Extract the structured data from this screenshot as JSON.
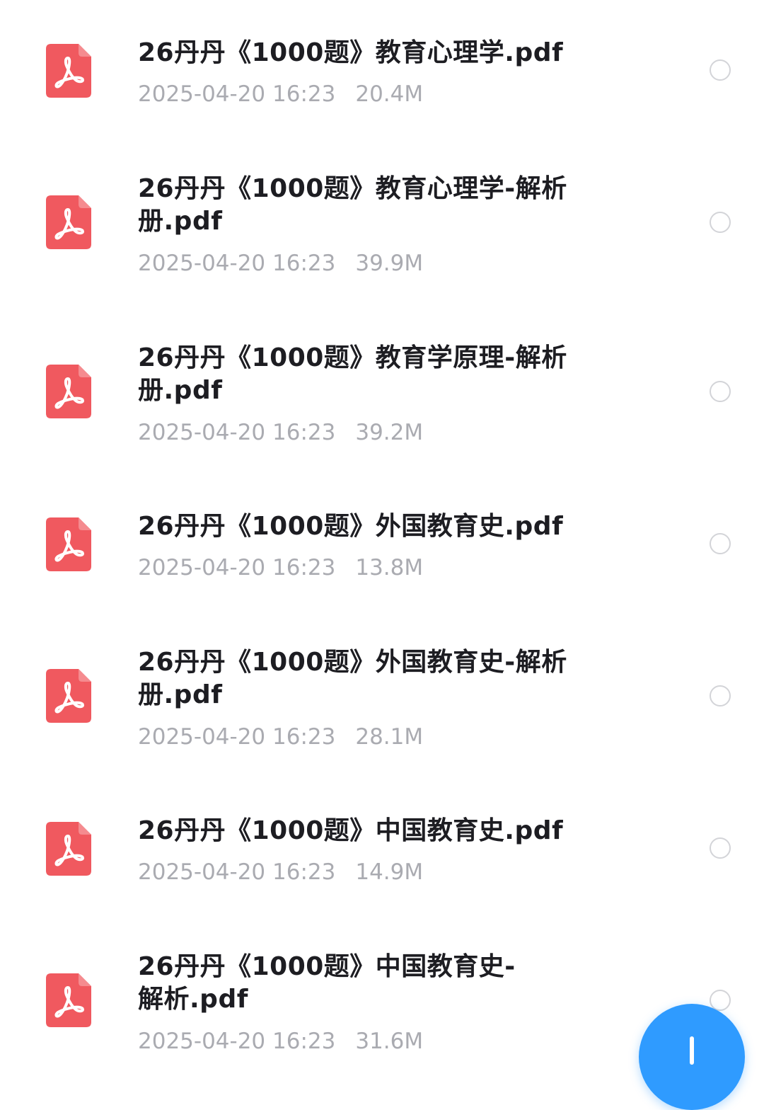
{
  "files": [
    {
      "name": "26丹丹《1000题》教育心理学.pdf",
      "date": "2025-04-20 16:23",
      "size": "20.4M",
      "selected": false
    },
    {
      "name": "26丹丹《1000题》教育心理学-解析册.pdf",
      "date": "2025-04-20 16:23",
      "size": "39.9M",
      "selected": false
    },
    {
      "name": "26丹丹《1000题》教育学原理-解析册.pdf",
      "date": "2025-04-20 16:23",
      "size": "39.2M",
      "selected": false
    },
    {
      "name": "26丹丹《1000题》外国教育史.pdf",
      "date": "2025-04-20 16:23",
      "size": "13.8M",
      "selected": false
    },
    {
      "name": "26丹丹《1000题》外国教育史-解析册.pdf",
      "date": "2025-04-20 16:23",
      "size": "28.1M",
      "selected": false
    },
    {
      "name": "26丹丹《1000题》中国教育史.pdf",
      "date": "2025-04-20 16:23",
      "size": "14.9M",
      "selected": false
    },
    {
      "name": "26丹丹《1000题》中国教育史-解析.pdf",
      "date": "2025-04-20 16:23",
      "size": "31.6M",
      "selected": false
    }
  ],
  "icons": {
    "file": "pdf-file-icon",
    "select": "radio-circle-icon",
    "fab": "plus-icon"
  },
  "colors": {
    "pdf_icon": "#f0595f",
    "title_text": "#1d1d22",
    "meta_text": "#aaabb1",
    "radio_border": "#d3d4d8",
    "fab": "#2f9bff"
  }
}
